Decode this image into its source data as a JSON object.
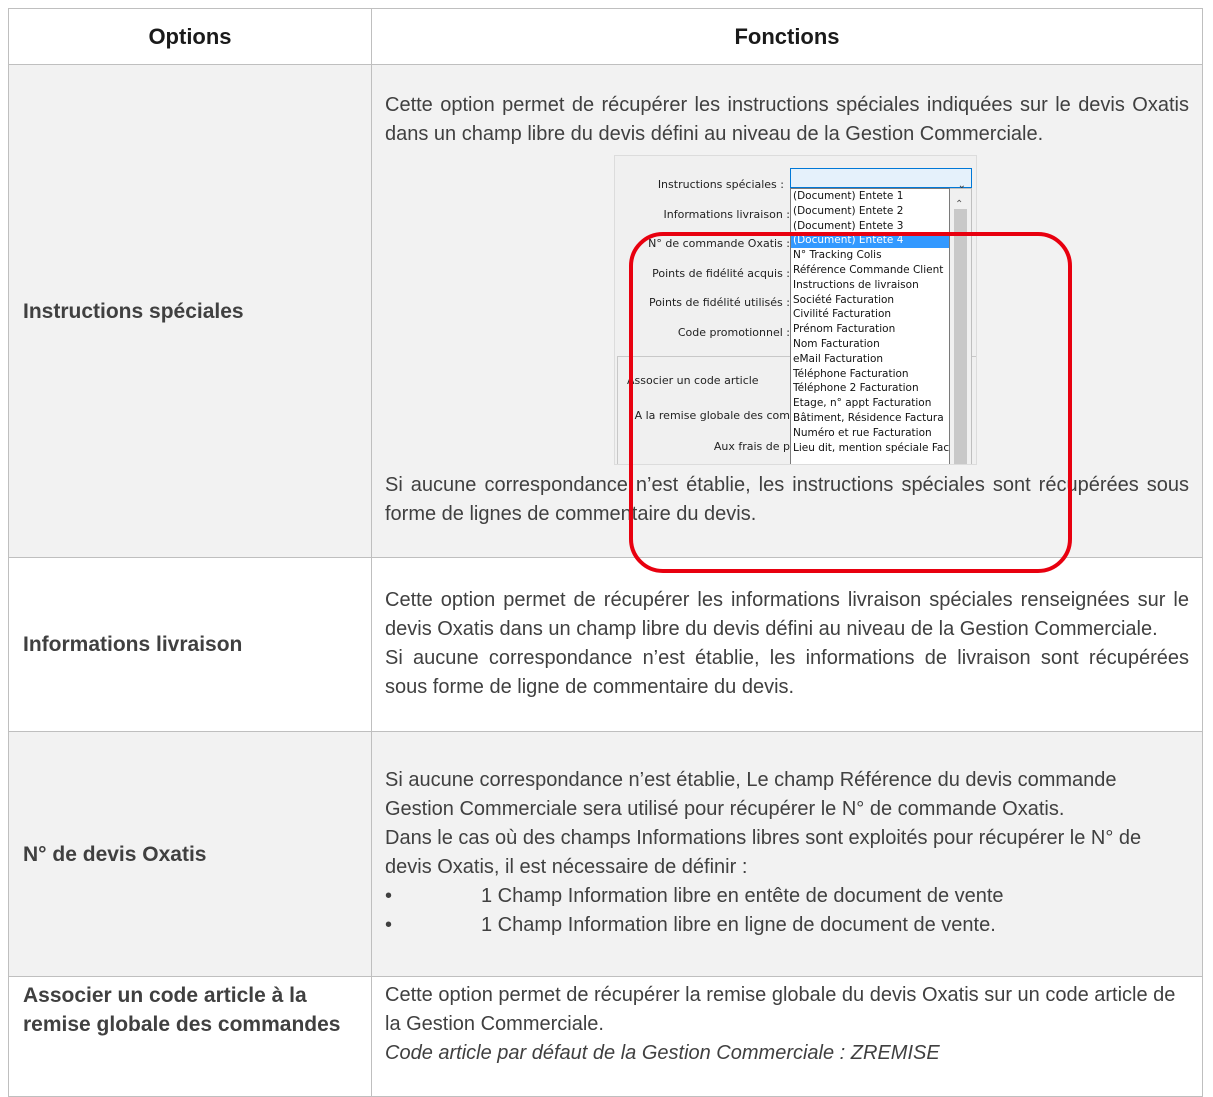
{
  "table": {
    "header_options": "Options",
    "header_fonctions": "Fonctions"
  },
  "rows": [
    {
      "option": "Instructions spéciales",
      "text_1": "Cette option permet de récupérer les instructions spéciales indiquées sur le devis Oxatis dans un champ libre du devis défini au niveau de la Gestion Commerciale.",
      "text_2": "Si aucune correspondance n’est établie, les instructions spéciales sont récupérées sous forme de lignes de commentaire du devis."
    },
    {
      "option": "Informations livraison",
      "text_1": "Cette option permet de récupérer les informations livraison spéciales renseignées sur le devis Oxatis dans un champ libre du devis défini au niveau de la Gestion Commerciale.",
      "text_2": "Si aucune correspondance n’est établie, les informations de livraison sont récupérées sous forme de ligne de commentaire du devis."
    },
    {
      "option": "N° de devis Oxatis",
      "text_1": "Si aucune correspondance n’est établie, Le champ Référence du devis commande Gestion Commerciale sera utilisé pour récupérer le N° de commande Oxatis.",
      "text_2": "Dans le cas où des champs Informations libres sont exploités pour récupérer le N° de devis Oxatis, il est nécessaire de définir :",
      "bullet_1": "1 Champ Information libre en entête de document de vente",
      "bullet_2": "1 Champ Information libre en ligne de document de vente.",
      "bullet_char": "•"
    },
    {
      "option": "Associer un code article à la remise globale des commandes",
      "text_1": "Cette option permet de récupérer la remise globale du devis Oxatis sur un code article de la Gestion Commerciale.",
      "text_2": "Code article par défaut de la Gestion Commerciale : ZREMISE"
    }
  ],
  "screenshot": {
    "labels": {
      "instructions": "Instructions spéciales :",
      "informations": "Informations livraison :",
      "commande": "N° de commande Oxatis :",
      "points_acquis": "Points de fidélité acquis :",
      "points_utilises": "Points de fidélité utilisés :",
      "code_promo": "Code promotionnel :",
      "remise_globale": "A la remise globale des com",
      "frais": "Aux frais de p"
    },
    "group_title": "Associer un code article",
    "dropdown_items": [
      "(Document) Entete 1",
      "(Document) Entete 2",
      "(Document) Entete 3",
      "(Document) Entete 4",
      "N° Tracking Colis",
      "Référence Commande Client",
      "Instructions de livraison",
      "Société Facturation",
      "Civilité Facturation",
      "Prénom Facturation",
      "Nom Facturation",
      "eMail Facturation",
      "Téléphone Facturation",
      "Téléphone 2 Facturation",
      "Etage, n° appt Facturation",
      "Bâtiment, Résidence Factura",
      "Numéro et rue Facturation",
      "Lieu dit, mention spéciale Fac"
    ],
    "selected_item": "(Document) Entete 4",
    "highlight_color": "#3399ff",
    "annotation_color": "#e8000f"
  }
}
